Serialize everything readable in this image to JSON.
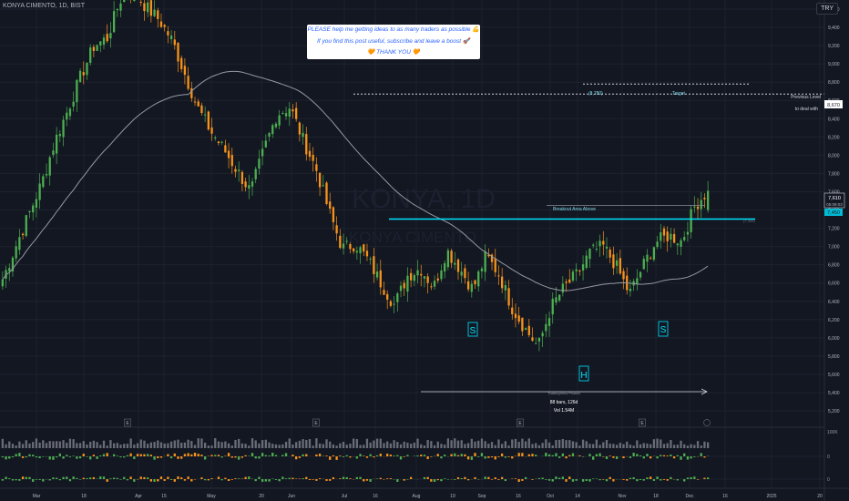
{
  "header": {
    "symbol": "KONYA CIMENTO, 1D, BIST",
    "currency": "TRY"
  },
  "watermark": {
    "ticker": "KONYA, 1D",
    "name": "KONYA CIMENTO"
  },
  "note": {
    "line1": "PLEASE help me getting ideas to as many traders as possible 💪",
    "line2": "If you find this post useful, subscribe and leave a boost 🚀",
    "line3": "🧡 THANK YOU 🧡"
  },
  "annotations": {
    "target_value": "(8,780)",
    "target_label": "Target",
    "previous_level": "Previous Level",
    "previous_level_2": "to deal with",
    "breakout": "Breakout Area Above",
    "neckline_value": "(7,300)",
    "shoulder_left": "S",
    "shoulder_right": "S",
    "head": "H",
    "range_posted": "TradingView Posted",
    "range_bars": "88 bars, 126d",
    "range_vol": "Vol 1.54M",
    "earnings_marker": "E"
  },
  "price_tags": {
    "level": "8,670",
    "last": "7,610",
    "countdown": "05:09:03",
    "prev": "7,450"
  },
  "colors": {
    "background": "#131722",
    "bull": "#4caf50",
    "bear": "#f7931a",
    "neckline": "#00e5ff",
    "ma": "#9598a1",
    "grid": "#1e222d",
    "text": "#b2b5be"
  },
  "chart_data": {
    "type": "candlestick",
    "title": "KONYA CIMENTO, 1D, BIST",
    "currency": "TRY",
    "ylim": [
      5160,
      9800
    ],
    "y_ticks": [
      5200,
      5400,
      5600,
      5800,
      6000,
      6200,
      6400,
      6600,
      6800,
      7000,
      7200,
      7400,
      7600,
      7800,
      8000,
      8200,
      8400,
      8600,
      8800,
      9000,
      9200,
      9400,
      9600
    ],
    "x_ticks": [
      "Mar",
      "18",
      "Apr",
      "15",
      "May",
      "20",
      "Jun",
      "Jul",
      "16",
      "Aug",
      "19",
      "Sep",
      "16",
      "Oct",
      "14",
      "Nov",
      "18",
      "Dec",
      "16",
      "2025",
      "20"
    ],
    "levels": {
      "previous_level": 8670,
      "target": 8780,
      "neckline": 7300,
      "breakout_area": 7450,
      "last_price": 7610
    },
    "pattern": {
      "name": "inverse head and shoulders",
      "left_shoulder_low": 6300,
      "head_low": 5820,
      "right_shoulder_low": 6350
    },
    "range_stats": {
      "bars": 88,
      "days": 126,
      "volume": "1.54M"
    },
    "volume_scale_label": "100K",
    "indicator_zero_label": "0",
    "series": [
      {
        "name": "price_anchor_closes",
        "values": [
          6640,
          7000,
          7350,
          7700,
          8150,
          8500,
          8870,
          9200,
          9280,
          9700,
          9800,
          9620,
          9480,
          9250,
          8870,
          8500,
          8250,
          8050,
          7820,
          7600,
          8060,
          8450,
          8530,
          8170,
          7850,
          7380,
          6980,
          7030,
          6850,
          6590,
          6360,
          6680,
          6760,
          6550,
          6960,
          6760,
          6530,
          6900,
          6700,
          6330,
          6100,
          5900,
          6340,
          6550,
          6700,
          6940,
          7000,
          6780,
          6480,
          6780,
          7050,
          7120,
          7060,
          7450,
          7610
        ]
      }
    ]
  }
}
